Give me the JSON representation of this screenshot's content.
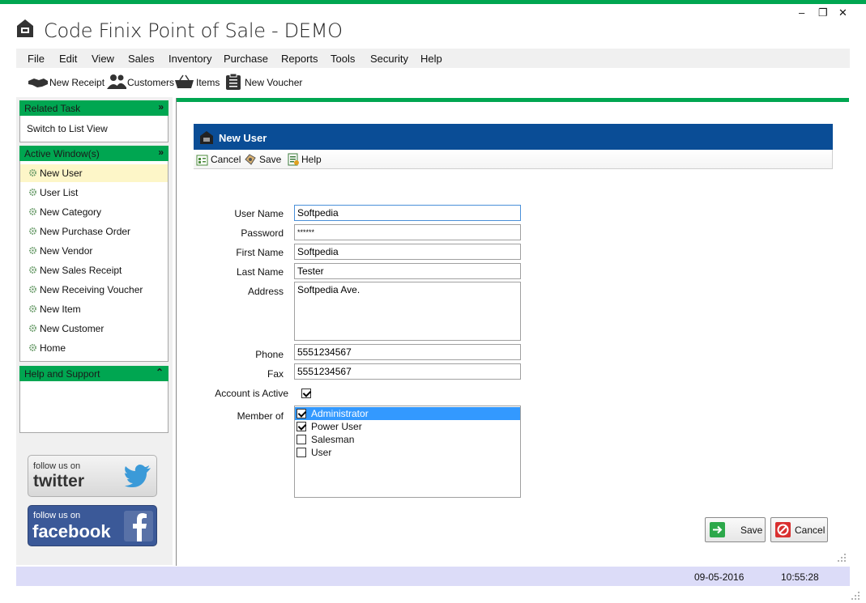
{
  "app": {
    "title": "Code Finix Point of Sale - DEMO",
    "accent_color": "#00a651",
    "header_color": "#0a4d96"
  },
  "window_controls": {
    "minimize": "–",
    "restore": "❐",
    "close": "✕"
  },
  "menu": [
    "File",
    "Edit",
    "View",
    "Sales",
    "Inventory",
    "Purchase",
    "Reports",
    "Tools",
    "Security",
    "Help"
  ],
  "toolbar": {
    "new_receipt": "New Receipt",
    "customers": "Customers",
    "items": "Items",
    "new_voucher": "New Voucher"
  },
  "sidebar": {
    "related_task": {
      "title": "Related Task",
      "items": [
        "Switch to List View"
      ]
    },
    "active_windows": {
      "title": "Active Window(s)",
      "items": [
        "New User",
        "User List",
        "New Category",
        "New Purchase Order",
        "New Vendor",
        "New Sales Receipt",
        "New Receiving Voucher",
        "New Item",
        "New Customer",
        "Home"
      ],
      "active_index": 0
    },
    "help_support": {
      "title": "Help and Support"
    },
    "social": {
      "twitter_line1": "follow us on",
      "twitter_line2": "twitter",
      "facebook_line1": "follow us on",
      "facebook_line2": "facebook"
    }
  },
  "form": {
    "title": "New User",
    "toolbar": {
      "cancel": "Cancel",
      "save": "Save",
      "help": "Help"
    },
    "labels": {
      "user_name": "User Name",
      "password": "Password",
      "first_name": "First Name",
      "last_name": "Last Name",
      "address": "Address",
      "phone": "Phone",
      "fax": "Fax",
      "account_active": "Account is Active",
      "member_of": "Member of"
    },
    "values": {
      "user_name": "Softpedia",
      "password": "******",
      "first_name": "Softpedia",
      "last_name": "Tester",
      "address": "Softpedia Ave.",
      "phone": "5551234567",
      "fax": "5551234567",
      "account_active": true
    },
    "members": [
      {
        "name": "Administrator",
        "checked": true,
        "selected": true
      },
      {
        "name": "Power User",
        "checked": true,
        "selected": false
      },
      {
        "name": "Salesman",
        "checked": false,
        "selected": false
      },
      {
        "name": "User",
        "checked": false,
        "selected": false
      }
    ],
    "buttons": {
      "save": "Save",
      "cancel": "Cancel"
    }
  },
  "status": {
    "date": "09-05-2016",
    "time": "10:55:28"
  }
}
